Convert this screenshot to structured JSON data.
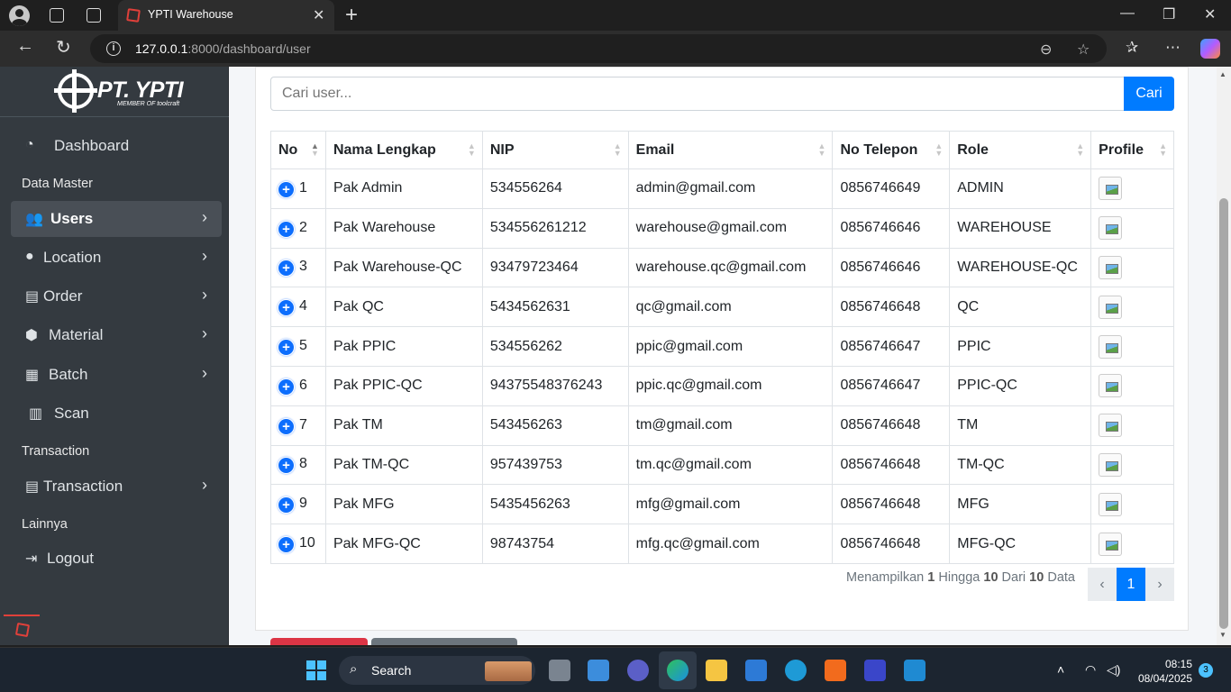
{
  "browser": {
    "tab_title": "YPTI Warehouse",
    "url_host": "127.0.0.1",
    "url_rest": ":8000/dashboard/user"
  },
  "brand": {
    "name": "PT. YPTI",
    "sub": "MEMBER OF toolcraft"
  },
  "sidebar": {
    "dashboard": "Dashboard",
    "header_data_master": "Data Master",
    "items": [
      {
        "label": "Users"
      },
      {
        "label": "Location"
      },
      {
        "label": "Order"
      },
      {
        "label": "Material"
      },
      {
        "label": "Batch"
      },
      {
        "label": "Scan"
      }
    ],
    "header_transaction": "Transaction",
    "transaction": "Transaction",
    "header_other": "Lainnya",
    "logout": "Logout"
  },
  "search": {
    "placeholder": "Cari user...",
    "button": "Cari"
  },
  "table": {
    "columns": [
      "No",
      "Nama Lengkap",
      "NIP",
      "Email",
      "No Telepon",
      "Role",
      "Profile"
    ],
    "rows": [
      {
        "no": "1",
        "name": "Pak Admin",
        "nip": "534556264",
        "email": "admin@gmail.com",
        "phone": "0856746649",
        "role": "ADMIN"
      },
      {
        "no": "2",
        "name": "Pak Warehouse",
        "nip": "534556261212",
        "email": "warehouse@gmail.com",
        "phone": "0856746646",
        "role": "WAREHOUSE"
      },
      {
        "no": "3",
        "name": "Pak Warehouse-QC",
        "nip": "93479723464",
        "email": "warehouse.qc@gmail.com",
        "phone": "0856746646",
        "role": "WAREHOUSE-QC"
      },
      {
        "no": "4",
        "name": "Pak QC",
        "nip": "5434562631",
        "email": "qc@gmail.com",
        "phone": "0856746648",
        "role": "QC"
      },
      {
        "no": "5",
        "name": "Pak PPIC",
        "nip": "534556262",
        "email": "ppic@gmail.com",
        "phone": "0856746647",
        "role": "PPIC"
      },
      {
        "no": "6",
        "name": "Pak PPIC-QC",
        "nip": "94375548376243",
        "email": "ppic.qc@gmail.com",
        "phone": "0856746647",
        "role": "PPIC-QC"
      },
      {
        "no": "7",
        "name": "Pak TM",
        "nip": "543456263",
        "email": "tm@gmail.com",
        "phone": "0856746648",
        "role": "TM"
      },
      {
        "no": "8",
        "name": "Pak TM-QC",
        "nip": "957439753",
        "email": "tm.qc@gmail.com",
        "phone": "0856746648",
        "role": "TM-QC"
      },
      {
        "no": "9",
        "name": "Pak MFG",
        "nip": "5435456263",
        "email": "mfg@gmail.com",
        "phone": "0856746648",
        "role": "MFG"
      },
      {
        "no": "10",
        "name": "Pak MFG-QC",
        "nip": "98743754",
        "email": "mfg.qc@gmail.com",
        "phone": "0856746648",
        "role": "MFG-QC"
      }
    ]
  },
  "pagination": {
    "info_prefix": "Menampilkan",
    "from": "1",
    "to_word": "Hingga",
    "to": "10",
    "of_word": "Dari",
    "total": "10",
    "suffix": "Data",
    "prev": "‹",
    "current": "1",
    "next": "›"
  },
  "taskbar": {
    "search_label": "Search",
    "time": "08:15",
    "date": "08/04/2025",
    "notifications": "3"
  },
  "colors": {
    "primary": "#007bff",
    "sidebar": "#343a40",
    "danger": "#dc3545"
  }
}
